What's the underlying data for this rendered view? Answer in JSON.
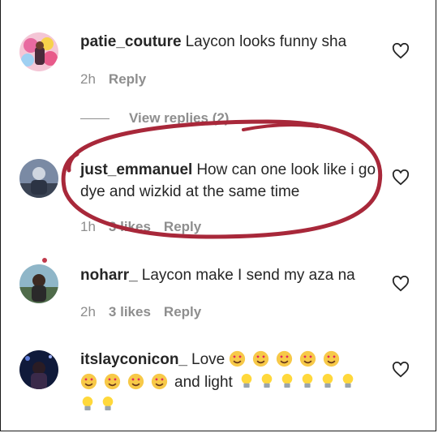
{
  "comments": [
    {
      "username": "patie_couture",
      "text": "Laycon looks funny sha",
      "time": "2h",
      "reply": "Reply"
    },
    {
      "username": "just_emmanuel",
      "text": "How can one look like i go dye and wizkid at the same time",
      "time": "1h",
      "likes": "3 likes",
      "reply": "Reply"
    },
    {
      "username": "noharr_",
      "text": "Laycon make I send my aza na",
      "time": "2h",
      "likes": "3 likes",
      "reply": "Reply"
    },
    {
      "username": "itslayconicon_",
      "text_prefix": "Love",
      "text_middle": "and light"
    }
  ],
  "view_replies": "View replies (2)",
  "colors": {
    "annotation": "#a8283a",
    "muted": "#8e8e8e",
    "text": "#262626"
  },
  "icons": {
    "like": "heart-outline-icon",
    "emoji_love": "heart-eyes-emoji",
    "emoji_light": "lightbulb-emoji"
  }
}
